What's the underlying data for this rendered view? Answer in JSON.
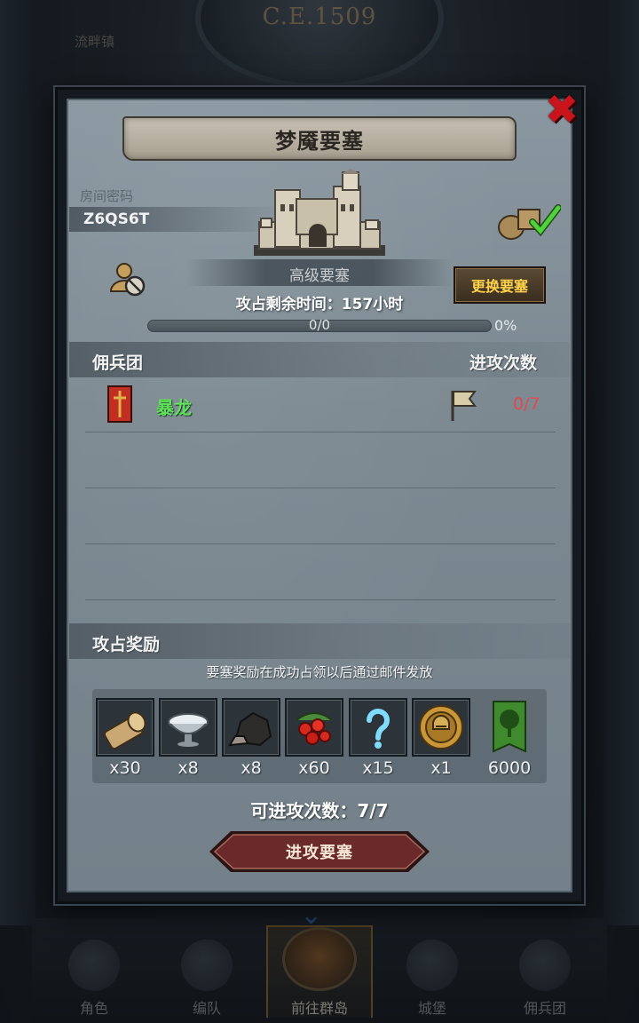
{
  "background": {
    "era": "C.E.1509",
    "location": "流畔镇"
  },
  "bottom_nav": {
    "items": [
      {
        "label": "角色",
        "icon": "knight-icon"
      },
      {
        "label": "编队",
        "icon": "squad-icon"
      },
      {
        "label": "前往群岛",
        "icon": "island-icon",
        "active": true
      },
      {
        "label": "城堡",
        "icon": "castle-icon"
      },
      {
        "label": "佣兵团",
        "icon": "mercenary-icon"
      }
    ]
  },
  "dialog": {
    "title": "梦魇要塞",
    "room_code_label": "房间密码",
    "room_code": "Z6QS6T",
    "fortress_level": "高级要塞",
    "change_button": "更换要塞",
    "time_left_label": "攻占剩余时间：",
    "time_left_value": "157小时",
    "progress": {
      "current": "0/0",
      "percent": "0%",
      "fraction": 0
    },
    "mercenary_section": "佣兵团",
    "attack_count_header": "进攻次数",
    "mercenary": {
      "name": "暴龙",
      "attacks": "0/7"
    },
    "reward_section": "攻占奖励",
    "reward_note": "要塞奖励在成功占领以后通过邮件发放",
    "rewards": [
      {
        "icon": "wood-log-icon",
        "qty": "x30"
      },
      {
        "icon": "silver-bowl-icon",
        "qty": "x8"
      },
      {
        "icon": "ore-rock-icon",
        "qty": "x8"
      },
      {
        "icon": "berries-icon",
        "qty": "x60"
      },
      {
        "icon": "mystery-question-icon",
        "qty": "x15"
      },
      {
        "icon": "helmet-coin-icon",
        "qty": "x1"
      },
      {
        "icon": "tree-banner-icon",
        "qty": "6000"
      }
    ],
    "attacks_available_label": "可进攻次数：",
    "attacks_available_value": "7/7",
    "attack_button": "进攻要塞"
  },
  "colors": {
    "close": "#c8141a",
    "merc_name": "#5fe257",
    "attack_count": "#e3484e",
    "change_btn_text": "#ffd24a",
    "attack_btn": "#6a2a2a"
  }
}
